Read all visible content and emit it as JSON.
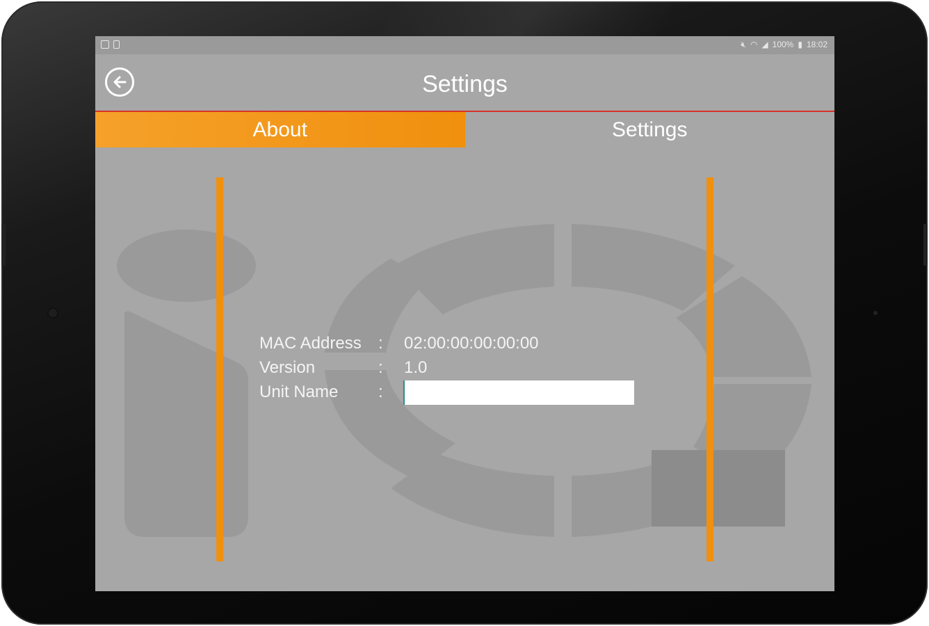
{
  "status_bar": {
    "left_icons": [
      "image-icon",
      "battery-saver-icon"
    ],
    "right_icons": [
      "mute-icon",
      "wifi-icon",
      "signal-icon"
    ],
    "battery_text": "100%",
    "time": "18:02"
  },
  "app_bar": {
    "title": "Settings",
    "back_icon": "back-arrow-icon"
  },
  "tabs": [
    {
      "label": "About",
      "active": true
    },
    {
      "label": "Settings",
      "active": false
    }
  ],
  "about": {
    "mac_label": "MAC Address",
    "mac_value": "02:00:00:00:00:00",
    "version_label": "Version",
    "version_value": "1.0",
    "unit_name_label": "Unit Name",
    "unit_name_value": "",
    "separator": ":"
  },
  "colors": {
    "accent_orange": "#f0900e",
    "screen_bg": "#a7a7a7",
    "divider_red": "#d6322a"
  }
}
